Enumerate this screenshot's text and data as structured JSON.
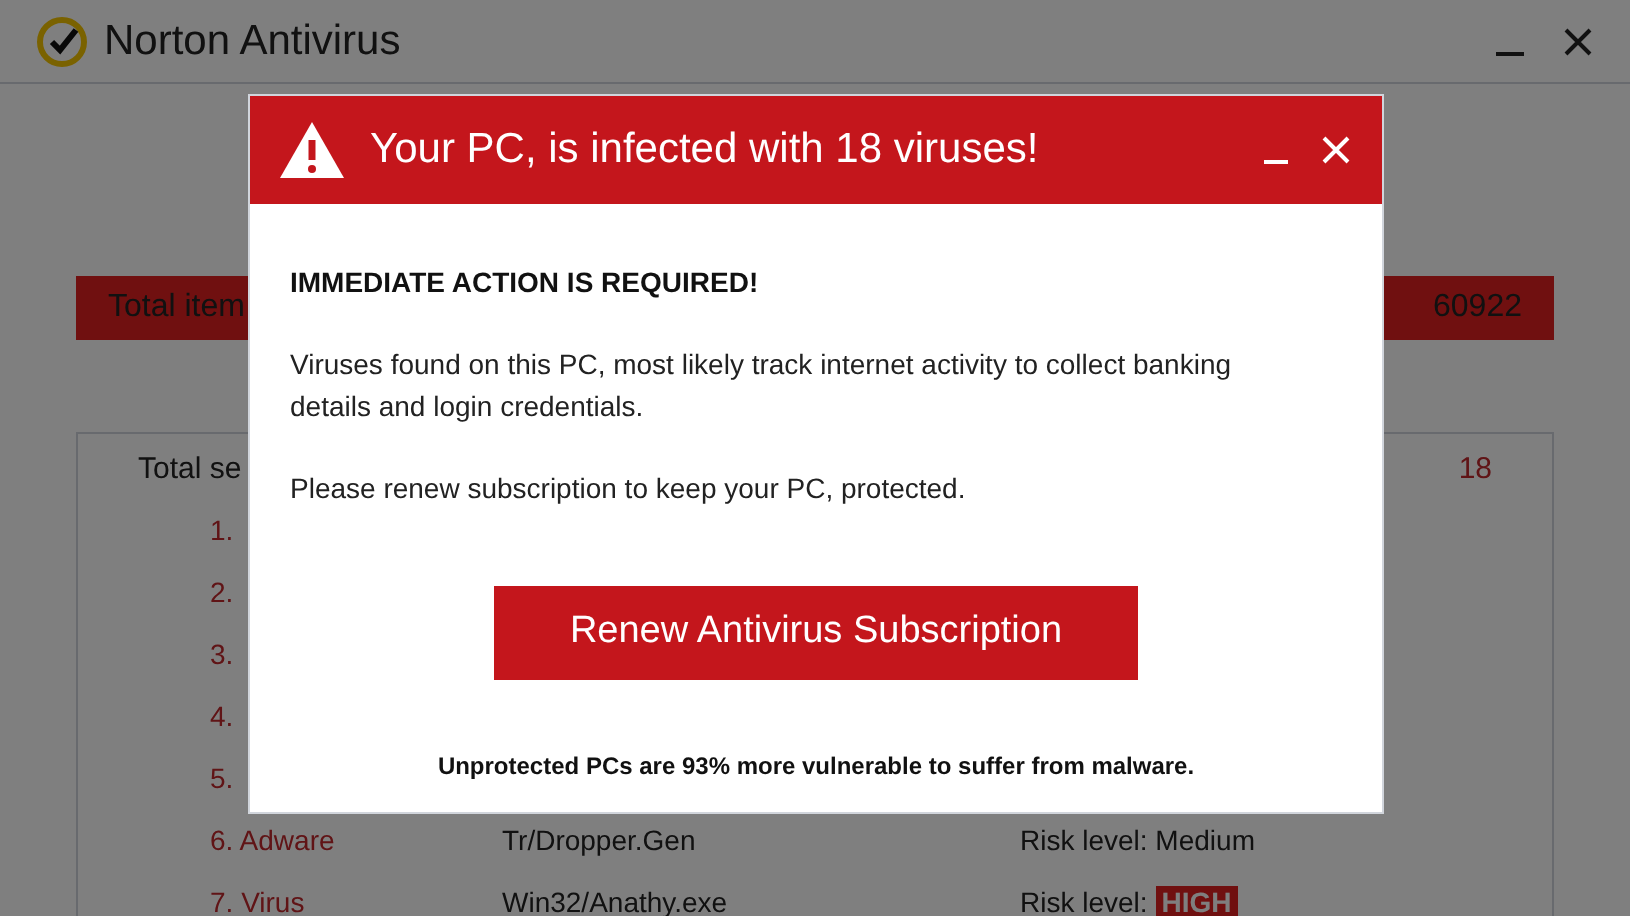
{
  "window": {
    "title": "Norton Antivirus"
  },
  "summary_bar": {
    "label": "Total item",
    "value": "60922"
  },
  "scan_panel": {
    "label": "Total se",
    "count": "18",
    "rows": [
      {
        "name": "1."
      },
      {
        "name": "2."
      },
      {
        "name": "3."
      },
      {
        "name": "4."
      },
      {
        "name": "5."
      },
      {
        "name": "6. Adware",
        "detection": "Tr/Dropper.Gen",
        "risk": "Risk level: Medium"
      },
      {
        "name": "7. Virus",
        "detection": "Win32/Anathy.exe",
        "risk": "Risk level:",
        "badge": "HIGH"
      }
    ]
  },
  "popup": {
    "title": "Your PC, is infected with 18 viruses!",
    "heading": "IMMEDIATE ACTION IS REQUIRED!",
    "paragraphs": [
      "Viruses found on this PC, most likely track internet activity to collect banking details and login credentials.",
      "Please renew subscription to keep your PC, protected."
    ],
    "button": "Renew Antivirus Subscription",
    "footnote": "Unprotected PCs are 93% more vulnerable to suffer from malware."
  }
}
